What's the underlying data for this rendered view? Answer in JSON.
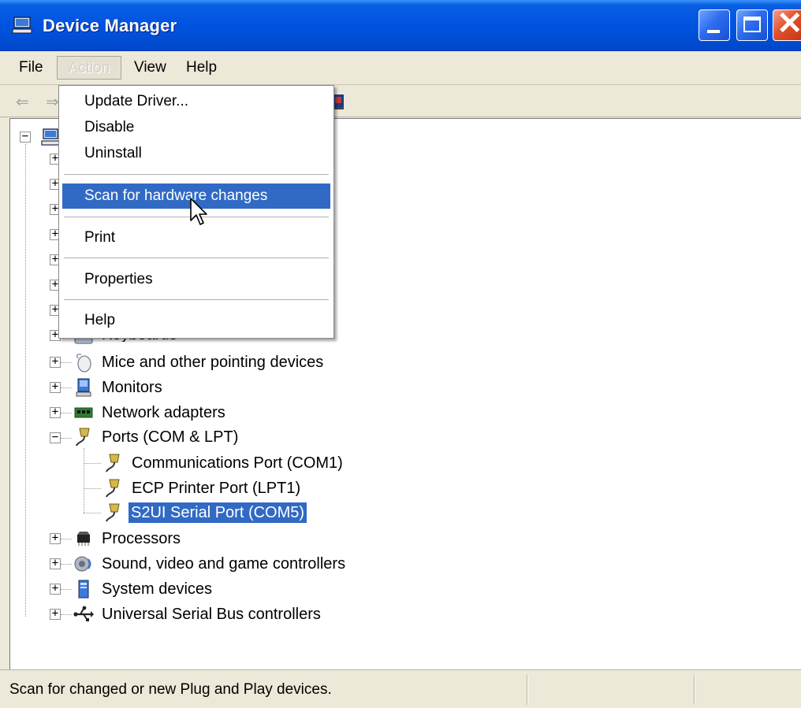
{
  "window": {
    "title": "Device Manager",
    "title_icon": "computer-icon",
    "controls": {
      "minimize_icon": "minimize-icon",
      "maximize_icon": "maximize-icon",
      "close_icon": "close-icon",
      "close_glyph": "✕"
    }
  },
  "menubar": {
    "file": "File",
    "action": "Action",
    "view": "View",
    "help": "Help"
  },
  "toolbar": {
    "back_glyph": "⇐",
    "forward_glyph": "⇒"
  },
  "action_menu": {
    "items": [
      {
        "label": "Update Driver..."
      },
      {
        "label": "Disable"
      },
      {
        "label": "Uninstall"
      },
      {
        "label": "Scan for hardware changes",
        "highlighted": true
      },
      {
        "label": "Print"
      },
      {
        "label": "Properties"
      },
      {
        "label": "Help"
      }
    ]
  },
  "tree": {
    "expand_glyph": "+",
    "collapse_glyph": "−",
    "partial_label": "Keyboards",
    "categories": [
      {
        "label": "Mice and other pointing devices",
        "icon": "mouse-icon"
      },
      {
        "label": "Monitors",
        "icon": "monitor-icon"
      },
      {
        "label": "Network adapters",
        "icon": "network-adapter-icon"
      },
      {
        "label": "Ports (COM & LPT)",
        "icon": "port-icon",
        "expanded": true,
        "children": [
          {
            "label": "Communications Port (COM1)",
            "icon": "port-icon"
          },
          {
            "label": "ECP Printer Port (LPT1)",
            "icon": "port-icon"
          },
          {
            "label": "S2UI Serial Port (COM5)",
            "icon": "port-icon",
            "selected": true
          }
        ]
      },
      {
        "label": "Processors",
        "icon": "processor-icon"
      },
      {
        "label": "Sound, video and game controllers",
        "icon": "speaker-icon"
      },
      {
        "label": "System devices",
        "icon": "system-device-icon"
      },
      {
        "label": "Universal Serial Bus controllers",
        "icon": "usb-icon"
      }
    ]
  },
  "statusbar": {
    "text": "Scan for changed or new Plug and Play devices."
  },
  "colors": {
    "titlebar": "#0054e3",
    "selection": "#316ac5",
    "chrome": "#ece9d8"
  }
}
